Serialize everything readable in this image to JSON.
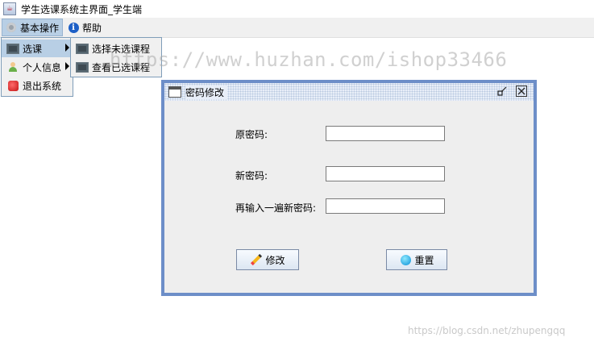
{
  "window": {
    "title": "学生选课系统主界面_学生端"
  },
  "menubar": {
    "menus": [
      {
        "label": "基本操作",
        "icon": "gear-icon"
      },
      {
        "label": "帮助",
        "icon": "info-icon"
      }
    ]
  },
  "dropdown": {
    "items": [
      {
        "label": "选课",
        "icon": "chalkboard-icon"
      },
      {
        "label": "个人信息",
        "icon": "person-icon"
      },
      {
        "label": "退出系统",
        "icon": "stop-icon"
      }
    ]
  },
  "submenu": {
    "items": [
      {
        "label": "选择未选课程",
        "icon": "chalkboard-icon"
      },
      {
        "label": "查看已选课程",
        "icon": "chalkboard-icon"
      }
    ]
  },
  "dialog": {
    "title": "密码修改",
    "old_password_label": "原密码:",
    "new_password_label": "新密码:",
    "confirm_password_label": "再输入一遍新密码:",
    "old_password_value": "",
    "new_password_value": "",
    "confirm_password_value": "",
    "modify_button": "修改",
    "reset_button": "重置"
  },
  "watermarks": {
    "overlay": "https://www.huzhan.com/ishop33466",
    "corner": "https://blog.csdn.net/zhupengqq"
  },
  "colors": {
    "frame_border": "#6d8ec8",
    "menu_highlight": "#b8cfe5"
  }
}
